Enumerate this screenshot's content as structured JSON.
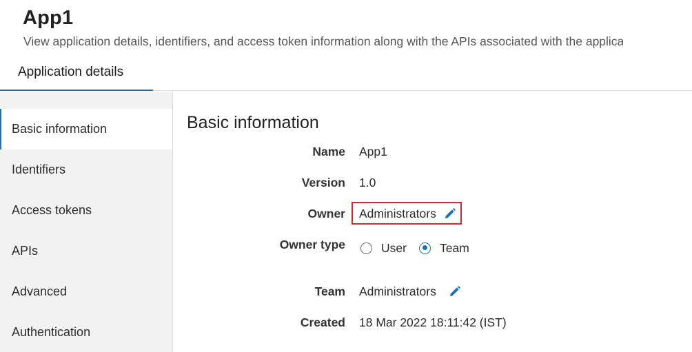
{
  "header": {
    "title": "App1",
    "description": "View application details, identifiers, and access token information along with the APIs associated with the applica"
  },
  "tabs": [
    {
      "label": "Application details",
      "active": true
    }
  ],
  "sidebar": {
    "items": [
      {
        "label": "Basic information",
        "active": true
      },
      {
        "label": "Identifiers"
      },
      {
        "label": "Access tokens"
      },
      {
        "label": "APIs"
      },
      {
        "label": "Advanced"
      },
      {
        "label": "Authentication"
      }
    ]
  },
  "main": {
    "section_title": "Basic information",
    "fields": {
      "name": {
        "label": "Name",
        "value": "App1"
      },
      "version": {
        "label": "Version",
        "value": "1.0"
      },
      "owner": {
        "label": "Owner",
        "value": "Administrators",
        "icon": "pencil-edit-icon"
      },
      "owner_type": {
        "label": "Owner type",
        "options": [
          {
            "label": "User",
            "selected": false
          },
          {
            "label": "Team",
            "selected": true
          }
        ]
      },
      "team": {
        "label": "Team",
        "value": "Administrators",
        "icon": "pencil-edit-icon"
      },
      "created": {
        "label": "Created",
        "value": "18 Mar 2022 18:11:42 (IST)"
      }
    }
  },
  "colors": {
    "accent": "#1f6fb5",
    "highlight_border": "#d9242a",
    "sidebar_bg": "#f2f2f2"
  }
}
